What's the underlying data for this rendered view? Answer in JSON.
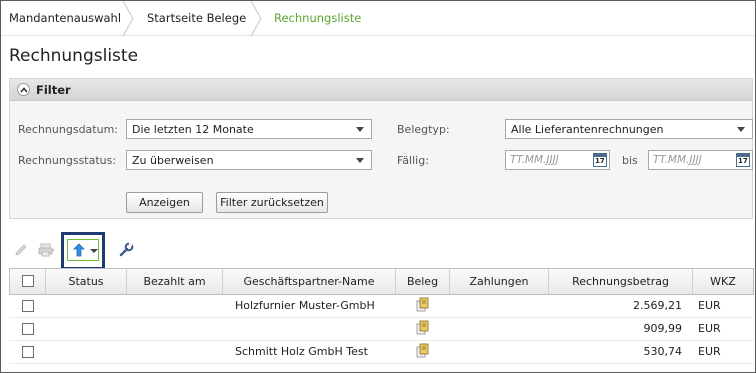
{
  "breadcrumb": {
    "items": [
      "Mandantenauswahl",
      "Startseite Belege",
      "Rechnungsliste"
    ]
  },
  "page": {
    "title": "Rechnungsliste"
  },
  "filter": {
    "title": "Filter",
    "rechnungsdatum": {
      "label": "Rechnungsdatum:",
      "value": "Die letzten 12 Monate"
    },
    "rechnungsstatus": {
      "label": "Rechnungsstatus:",
      "value": "Zu überweisen"
    },
    "belegtyp": {
      "label": "Belegtyp:",
      "value": "Alle Lieferantenrechnungen"
    },
    "faellig": {
      "label": "Fällig:",
      "from_placeholder": "TT.MM.JJJJ",
      "bis": "bis",
      "to_placeholder": "TT.MM.JJJJ"
    },
    "calendar_day": "17",
    "show_button": "Anzeigen",
    "reset_button": "Filter zurücksetzen"
  },
  "toolbar": {
    "icons": [
      "pencil-icon",
      "print-icon",
      "sort-upload-icon",
      "wrench-icon"
    ],
    "accent": "#1f3a6e",
    "sort_border": "#6cbf3c"
  },
  "table": {
    "columns": [
      "Status",
      "Bezahlt am",
      "Geschäftspartner-Name",
      "Beleg",
      "Zahlungen",
      "Rechnungsbetrag",
      "WKZ"
    ],
    "rows": [
      {
        "status": "",
        "bezahlt_am": "",
        "partner": "Holzfurnier Muster-GmbH",
        "betrag": "2.569,21",
        "wkz": "EUR"
      },
      {
        "status": "",
        "bezahlt_am": "",
        "partner": "",
        "betrag": "909,99",
        "wkz": "EUR"
      },
      {
        "status": "",
        "bezahlt_am": "",
        "partner": "Schmitt Holz GmbH Test",
        "betrag": "530,74",
        "wkz": "EUR"
      }
    ]
  },
  "colors": {
    "active_crumb": "#5aa631",
    "frame": "#5b5b5b"
  }
}
